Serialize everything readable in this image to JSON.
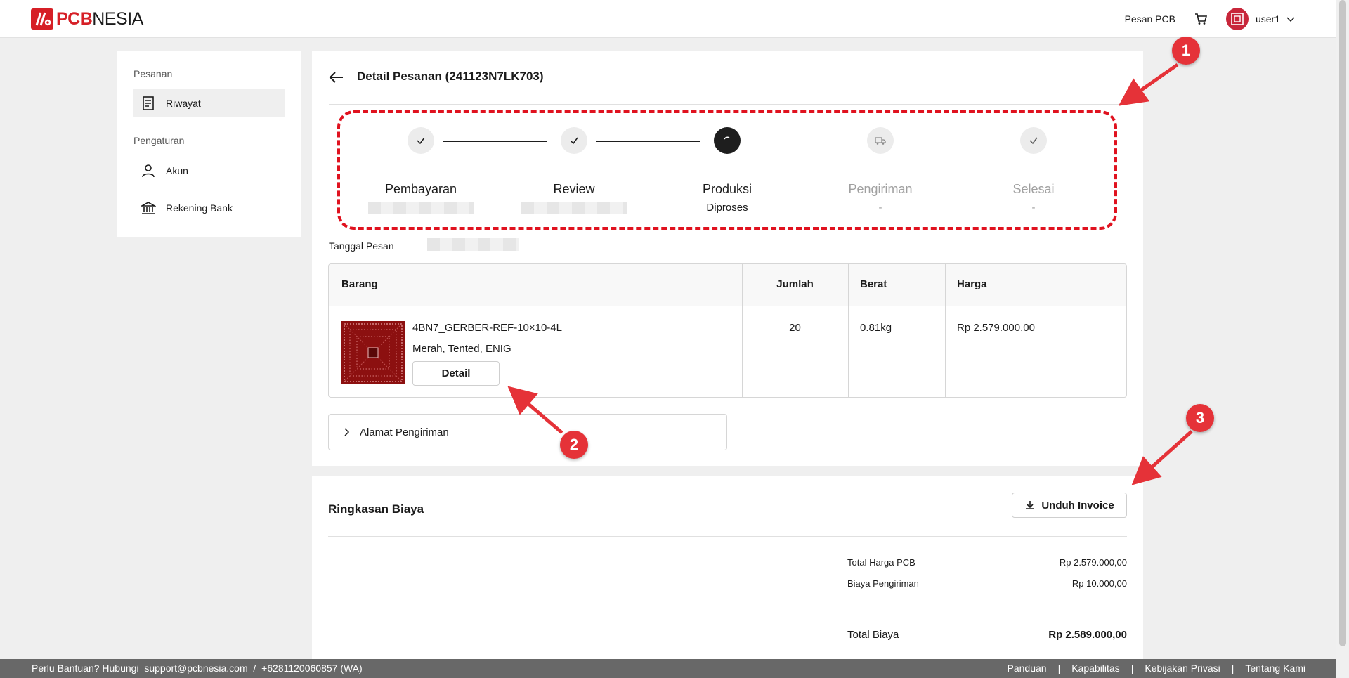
{
  "header": {
    "logo_pcb": "PCB",
    "logo_nesia": "NESIA",
    "nav_link": "Pesan PCB",
    "user_name": "user1"
  },
  "sidebar": {
    "group_orders": "Pesanan",
    "item_history": "Riwayat",
    "group_settings": "Pengaturan",
    "item_account": "Akun",
    "item_bank": "Rekening Bank"
  },
  "order": {
    "title": "Detail Pesanan (241123N7LK703)",
    "date_label": "Tanggal Pesan"
  },
  "steps": [
    {
      "label": "Pembayaran",
      "status": "done",
      "sub": ""
    },
    {
      "label": "Review",
      "status": "done",
      "sub": ""
    },
    {
      "label": "Produksi",
      "status": "current",
      "sub": "Diproses"
    },
    {
      "label": "Pengiriman",
      "status": "pending",
      "sub": "-"
    },
    {
      "label": "Selesai",
      "status": "pending",
      "sub": "-"
    }
  ],
  "table": {
    "headers": [
      "Barang",
      "Jumlah",
      "Berat",
      "Harga"
    ],
    "rows": [
      {
        "name": "4BN7_GERBER-REF-10×10-4L",
        "spec": "Merah, Tented, ENIG",
        "detail_label": "Detail",
        "qty": "20",
        "weight": "0.81kg",
        "price": "Rp 2.579.000,00"
      }
    ]
  },
  "address": {
    "label": "Alamat Pengiriman"
  },
  "summary": {
    "title": "Ringkasan Biaya",
    "invoice_label": "Unduh Invoice",
    "lines": [
      {
        "label": "Total Harga PCB",
        "value": "Rp 2.579.000,00"
      },
      {
        "label": "Biaya Pengiriman",
        "value": "Rp 10.000,00"
      }
    ],
    "total_label": "Total Biaya",
    "total_value": "Rp 2.589.000,00"
  },
  "footer": {
    "help": "Perlu Bantuan? Hubungi  support@pcbnesia.com  /  +6281120060857 (WA)",
    "links": [
      "Panduan",
      "Kapabilitas",
      "Kebijakan Privasi",
      "Tentang Kami"
    ]
  },
  "annotations": [
    "1",
    "2",
    "3"
  ],
  "colors": {
    "brand": "#d61f26",
    "annotation": "#e53238",
    "step_current": "#1e1e1e"
  }
}
